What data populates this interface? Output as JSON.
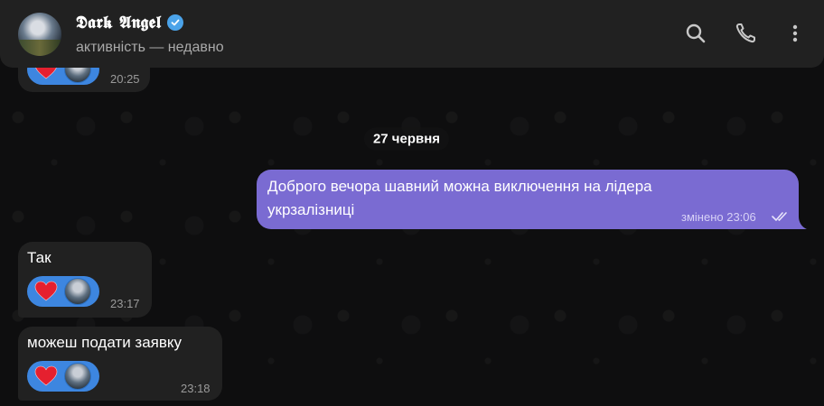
{
  "header": {
    "name": "𝕯𝖆𝖗𝖐 𝕬𝖓𝖌𝖊𝖑",
    "status": "активність — недавно",
    "icons": [
      "search-icon",
      "phone-icon",
      "more-vertical-icon"
    ]
  },
  "chat": {
    "date_separator": "27 червня",
    "messages": [
      {
        "direction": "in",
        "text": "",
        "time": "20:25",
        "reaction": "heart"
      },
      {
        "direction": "out",
        "text_line1": "Доброго вечора шавний можна виключення на лідера",
        "text_line2": "укрзалізниці",
        "time": "змінено 23:06",
        "read": true
      },
      {
        "direction": "in",
        "text": "Так",
        "time": "23:17",
        "reaction": "heart"
      },
      {
        "direction": "in",
        "text": "можеш подати заявку",
        "time": "23:18",
        "reaction": "heart"
      }
    ]
  },
  "colors": {
    "header_bg": "#212121",
    "incoming_bubble": "#212121",
    "outgoing_bubble": "#7a6bd2",
    "reaction_bg": "#3d86e0",
    "verified": "#4ba3e9"
  }
}
